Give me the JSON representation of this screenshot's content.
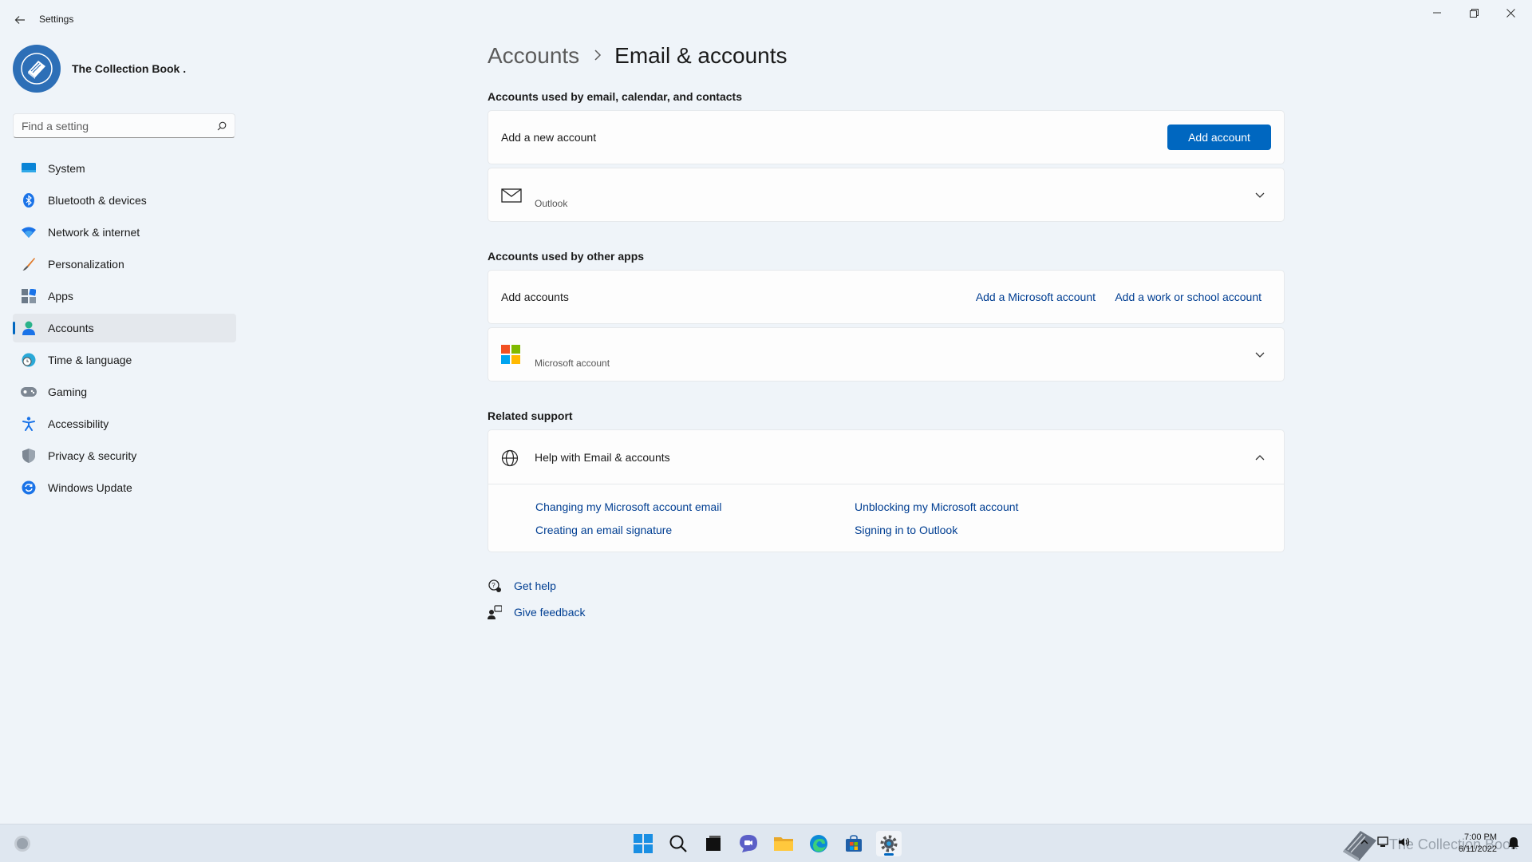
{
  "window": {
    "title": "Settings"
  },
  "profile": {
    "name": "The Collection Book ."
  },
  "search": {
    "placeholder": "Find a setting"
  },
  "sidebar": {
    "items": [
      {
        "label": "System",
        "icon": "system-icon"
      },
      {
        "label": "Bluetooth & devices",
        "icon": "bluetooth-icon"
      },
      {
        "label": "Network & internet",
        "icon": "wifi-icon"
      },
      {
        "label": "Personalization",
        "icon": "brush-icon"
      },
      {
        "label": "Apps",
        "icon": "apps-icon"
      },
      {
        "label": "Accounts",
        "icon": "person-icon"
      },
      {
        "label": "Time & language",
        "icon": "clock-globe-icon"
      },
      {
        "label": "Gaming",
        "icon": "gamepad-icon"
      },
      {
        "label": "Accessibility",
        "icon": "accessibility-icon"
      },
      {
        "label": "Privacy & security",
        "icon": "shield-icon"
      },
      {
        "label": "Windows Update",
        "icon": "update-icon"
      }
    ]
  },
  "breadcrumb": {
    "parent": "Accounts",
    "current": "Email & accounts"
  },
  "email_section": {
    "title": "Accounts used by email, calendar, and contacts",
    "add_label": "Add a new account",
    "add_button": "Add account",
    "account_type": "Outlook"
  },
  "other_apps_section": {
    "title": "Accounts used by other apps",
    "add_label": "Add accounts",
    "add_ms_link": "Add a Microsoft account",
    "add_work_link": "Add a work or school account",
    "account_type": "Microsoft account"
  },
  "support_section": {
    "title": "Related support",
    "help_title": "Help with Email & accounts",
    "links": [
      "Changing my Microsoft account email",
      "Unblocking my Microsoft account",
      "Creating an email signature",
      "Signing in to Outlook"
    ]
  },
  "footer_links": {
    "get_help": "Get help",
    "give_feedback": "Give feedback"
  },
  "taskbar": {
    "time": "7:00 PM",
    "date": "6/11/2022",
    "watermark": "The Collection Book"
  },
  "colors": {
    "accent": "#0067c0",
    "link": "#003e92",
    "background": "#eff4f9"
  }
}
